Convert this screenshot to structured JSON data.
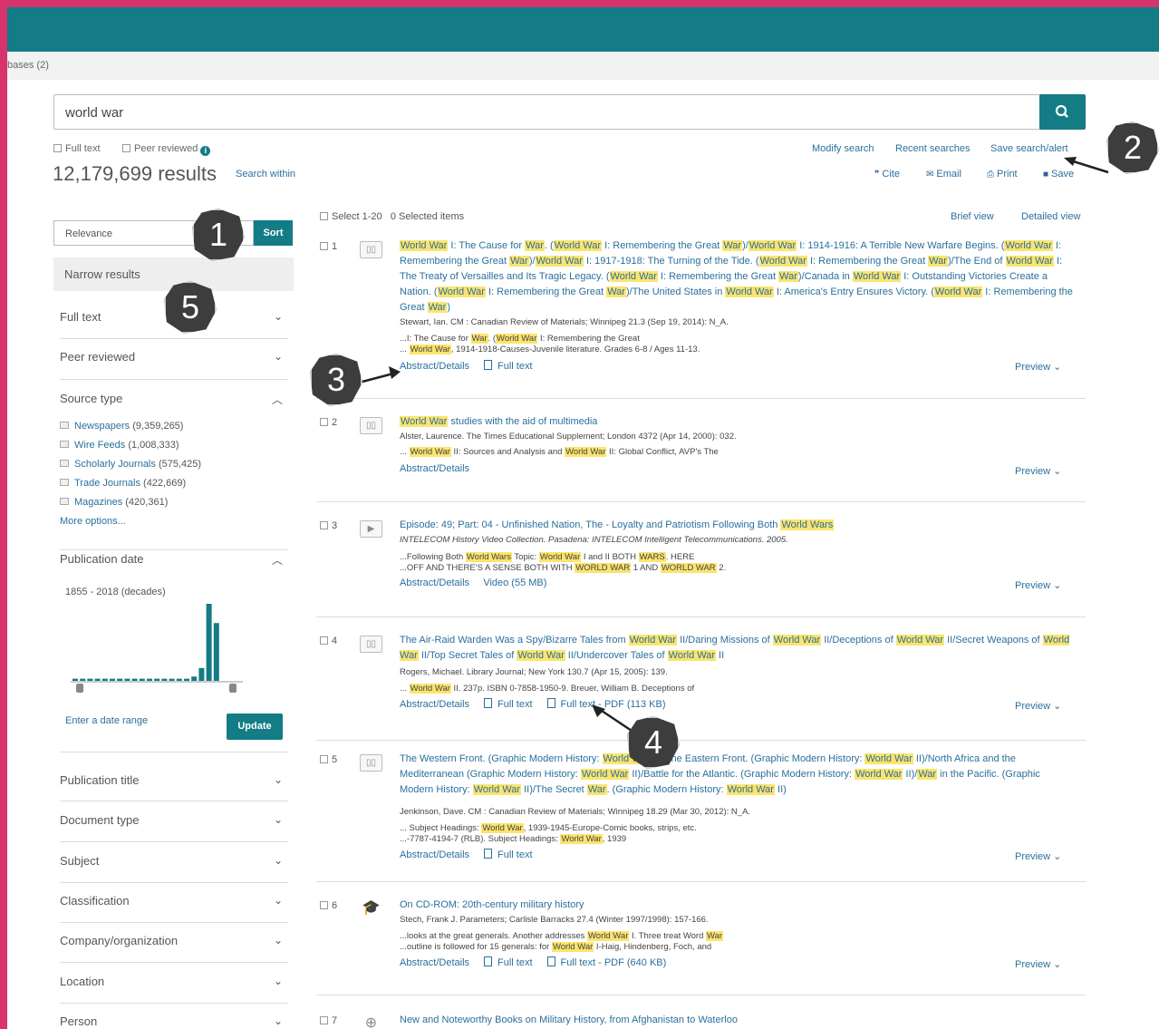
{
  "db_tab": "bases (2)",
  "search": {
    "value": "world war"
  },
  "options": {
    "full_text": "Full text",
    "peer_reviewed": "Peer reviewed"
  },
  "results_count": "12,179,699 results",
  "search_within": "Search within",
  "top_links": {
    "modify": "Modify search",
    "recent": "Recent searches",
    "save_alert": "Save search/alert"
  },
  "actions": {
    "cite": "Cite",
    "email": "Email",
    "print": "Print",
    "save": "Save"
  },
  "sort": {
    "selected": "Relevance",
    "button": "Sort"
  },
  "narrow_title": "Narrow results",
  "facets": {
    "full_text": "Full text",
    "peer_reviewed": "Peer reviewed",
    "source_type": "Source type",
    "publication_date": "Publication date",
    "publication_title": "Publication title",
    "document_type": "Document type",
    "subject": "Subject",
    "classification": "Classification",
    "company": "Company/organization",
    "location": "Location",
    "person": "Person"
  },
  "sources": [
    {
      "label": "Newspapers",
      "count": "(9,359,265)"
    },
    {
      "label": "Wire Feeds",
      "count": "(1,008,333)"
    },
    {
      "label": "Scholarly Journals",
      "count": "(575,425)"
    },
    {
      "label": "Trade Journals",
      "count": "(422,669)"
    },
    {
      "label": "Magazines",
      "count": "(420,361)"
    }
  ],
  "more_options": "More options...",
  "date_range": "1855 - 2018 (decades)",
  "date_histogram": [
    1,
    1,
    1,
    1,
    1,
    1,
    1,
    1,
    1,
    1,
    1,
    1,
    1,
    1,
    1,
    1,
    2,
    6,
    36,
    27
  ],
  "enter_date": "Enter a date range",
  "update": "Update",
  "select_range": "Select 1-20",
  "selected_items": "0 Selected items",
  "brief_view": "Brief view",
  "detailed_view": "Detailed view",
  "abstract": "Abstract/Details",
  "full_text_link": "Full text",
  "preview": "Preview",
  "results": [
    {
      "num": "1",
      "meta": "Stewart, Ian. CM : Canadian Review of Materials; Winnipeg 21.3 (Sep 19, 2014): N_A."
    },
    {
      "num": "2",
      "meta": "Alster, Laurence. The Times Educational Supplement; London 4372 (Apr 14, 2000): 032."
    },
    {
      "num": "3",
      "meta": "INTELECOM History Video Collection. Pasadena: INTELECOM Intelligent Telecommunications. 2005.",
      "video": "Video (55 MB)"
    },
    {
      "num": "4",
      "meta": "Rogers, Michael. Library Journal; New York 130.7 (Apr 15, 2005): 139.",
      "pdf": "Full text - PDF (113 KB)"
    },
    {
      "num": "5",
      "meta": "Jenkinson, Dave. CM : Canadian Review of Materials; Winnipeg 18.29 (Mar 30, 2012): N_A."
    },
    {
      "num": "6",
      "meta": "Stech, Frank J. Parameters; Carlisle Barracks 27.4 (Winter 1997/1998): 157-166.",
      "pdf": "Full text - PDF (640 KB)"
    },
    {
      "num": "7",
      "title": "New and Noteworthy Books on Military History, from Afghanistan to Waterloo"
    }
  ],
  "callouts": [
    "1",
    "2",
    "3",
    "4",
    "5"
  ]
}
